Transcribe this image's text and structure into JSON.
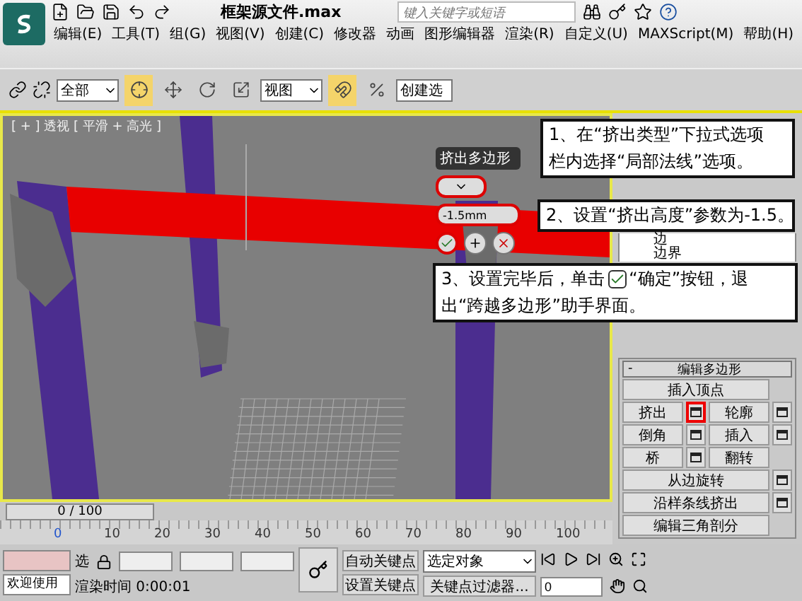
{
  "title": "框架源文件.max",
  "search": {
    "placeholder": "键入关键字或短语"
  },
  "menu": [
    {
      "label": "编辑(E)"
    },
    {
      "label": "工具(T)"
    },
    {
      "label": "组(G)"
    },
    {
      "label": "视图(V)"
    },
    {
      "label": "创建(C)"
    },
    {
      "label": "修改器"
    },
    {
      "label": "动画"
    },
    {
      "label": "图形编辑器"
    },
    {
      "label": "渲染(R)"
    },
    {
      "label": "自定义(U)"
    },
    {
      "label": "MAXScript(M)"
    },
    {
      "label": "帮助(H)"
    }
  ],
  "toolbar": {
    "selection_filter": "全部",
    "coord_system": "视图",
    "named_selection": "创建选"
  },
  "viewport": {
    "label": "[ + ] 透视 [ 平滑 + 高光 ]",
    "active": true
  },
  "caddy": {
    "title": "挤出多边形",
    "height": "-1.5mm"
  },
  "callouts": [
    {
      "lines": [
        "1、在“挤出类型”下拉式选项",
        "栏内选择“局部法线”选项。"
      ]
    },
    {
      "lines": [
        "2、设置“挤出高度”参数为-1.5。"
      ]
    },
    {
      "lines": [
        "3、设置完毕后，单击",
        "“确定”按钮，退",
        "出“跨越多边形”助手界面。"
      ]
    }
  ],
  "subobject_list": [
    "边",
    "边界"
  ],
  "rollout": {
    "title": "编辑多边形",
    "collapse": "-",
    "rows": [
      [
        {
          "label": "插入顶点",
          "kind": "plain"
        }
      ],
      [
        {
          "label": "挤出",
          "kind": "with_settings",
          "highlighted": true
        },
        {
          "label": "轮廓",
          "kind": "with_settings",
          "highlighted": false
        }
      ],
      [
        {
          "label": "倒角",
          "kind": "with_settings",
          "highlighted": false
        },
        {
          "label": "插入",
          "kind": "with_settings",
          "highlighted": false
        }
      ],
      [
        {
          "label": "桥",
          "kind": "with_settings",
          "highlighted": false
        },
        {
          "label": "翻转",
          "kind": "plain"
        }
      ],
      [
        {
          "label": "从边旋转",
          "kind": "with_settings",
          "highlighted": false
        }
      ],
      [
        {
          "label": "沿样条线挤出",
          "kind": "with_settings",
          "highlighted": false
        }
      ],
      [
        {
          "label": "编辑三角剖分",
          "kind": "plain"
        }
      ]
    ]
  },
  "time_slider": {
    "label": "0 / 100",
    "level": 0
  },
  "ruler": {
    "ticks": [
      "0",
      "10",
      "20",
      "30",
      "40",
      "50",
      "60",
      "70",
      "80",
      "90",
      "100"
    ]
  },
  "status": {
    "prompt": "欢迎使用",
    "selection_label": "选",
    "render_time": "渲染时间  0:00:01",
    "auto_key": "自动关键点",
    "set_key": "设置关键点",
    "key_mode": "选定对象",
    "key_filters": "关键点过滤器...",
    "frame": "0"
  }
}
